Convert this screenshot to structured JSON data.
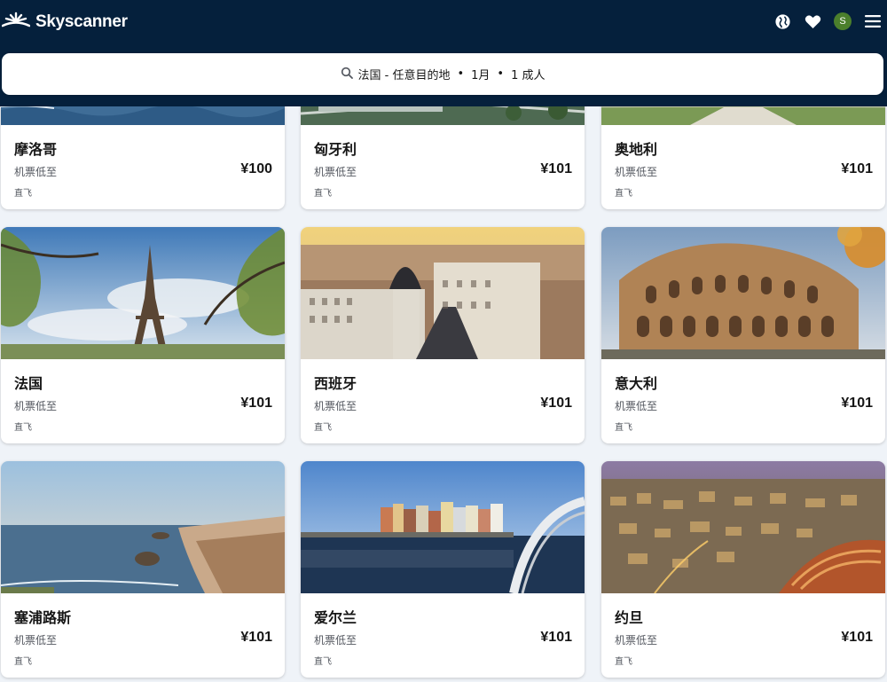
{
  "brand": {
    "name": "Skyscanner"
  },
  "header": {
    "icons": [
      "globe-icon",
      "heart-icon",
      "avatar",
      "menu-icon"
    ],
    "avatar_letter": "S"
  },
  "search": {
    "route": "法国 - 任意目的地",
    "sep1": "•",
    "month": "1月",
    "sep2": "•",
    "travellers": "1 成人"
  },
  "cards": [
    {
      "name": "摩洛哥",
      "subtitle": "机票低至",
      "price": "¥100",
      "direct": "直飞",
      "image": "sea-coast"
    },
    {
      "name": "匈牙利",
      "subtitle": "机票低至",
      "price": "¥101",
      "direct": "直飞",
      "image": "river-bridge"
    },
    {
      "name": "奥地利",
      "subtitle": "机票低至",
      "price": "¥101",
      "direct": "直飞",
      "image": "palace-garden"
    },
    {
      "name": "法国",
      "subtitle": "机票低至",
      "price": "¥101",
      "direct": "直飞",
      "image": "eiffel-tower"
    },
    {
      "name": "西班牙",
      "subtitle": "机票低至",
      "price": "¥101",
      "direct": "直飞",
      "image": "madrid-cityscape"
    },
    {
      "name": "意大利",
      "subtitle": "机票低至",
      "price": "¥101",
      "direct": "直飞",
      "image": "colosseum"
    },
    {
      "name": "塞浦路斯",
      "subtitle": "机票低至",
      "price": "¥101",
      "direct": "直飞",
      "image": "coastline-rock"
    },
    {
      "name": "爱尔兰",
      "subtitle": "机票低至",
      "price": "¥101",
      "direct": "直飞",
      "image": "ha-penny-bridge"
    },
    {
      "name": "约旦",
      "subtitle": "机票低至",
      "price": "¥101",
      "direct": "直飞",
      "image": "amman-night"
    }
  ],
  "colors": {
    "header_bg": "#05203c",
    "page_bg": "#eff3f8",
    "card_bg": "#ffffff",
    "text_primary": "#161616",
    "text_secondary": "#545860"
  }
}
